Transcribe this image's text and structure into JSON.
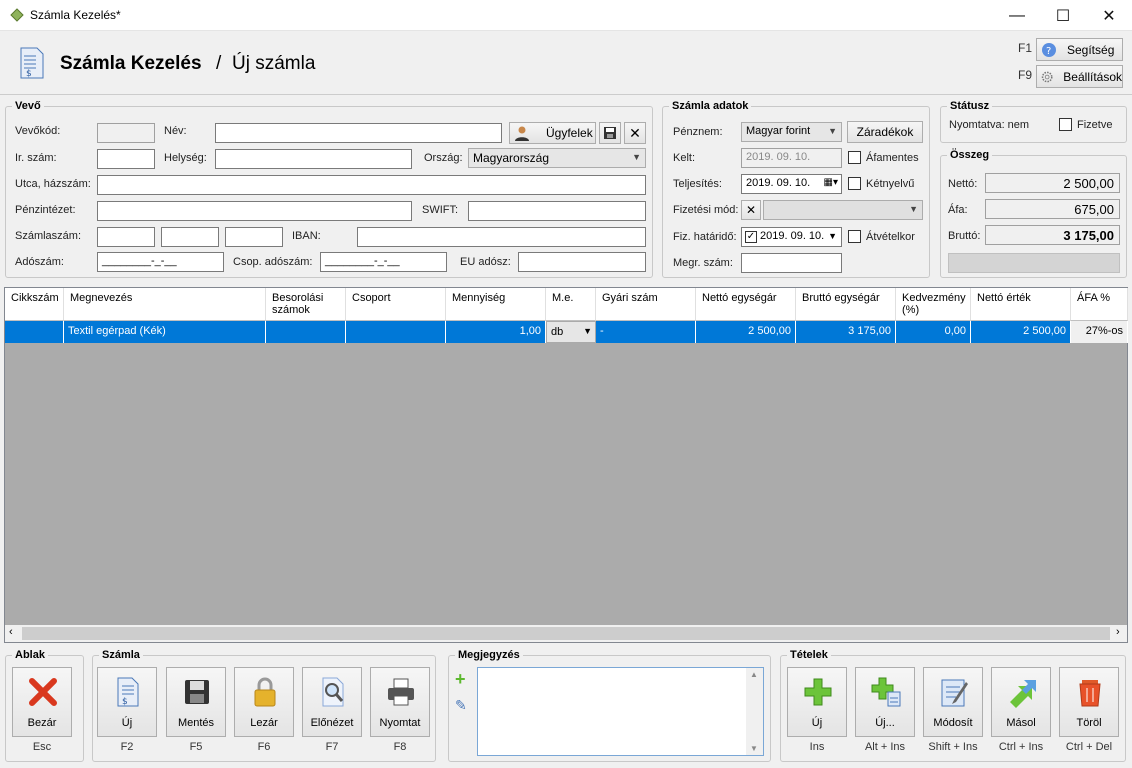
{
  "window": {
    "title": "Számla Kezelés*",
    "minimize": "—",
    "maximize": "☐",
    "close": "✕"
  },
  "header": {
    "title": "Számla Kezelés",
    "separator": "/",
    "subtitle": "Új számla",
    "help_key": "F1",
    "help_label": "Segítség",
    "settings_key": "F9",
    "settings_label": "Beállítások"
  },
  "vevo": {
    "legend": "Vevő",
    "vevokod_label": "Vevőkód:",
    "vevokod": "",
    "nev_label": "Név:",
    "nev": "",
    "ugyfelek": "Ügyfelek",
    "irszam_label": "Ir. szám:",
    "irszam": "",
    "helyseg_label": "Helység:",
    "helyseg": "",
    "orszag_label": "Ország:",
    "orszag": "Magyarország",
    "utca_label": "Utca, házszám:",
    "utca": "",
    "penzintezet_label": "Pénzintézet:",
    "penzintezet": "",
    "swift_label": "SWIFT:",
    "swift": "",
    "szamlaszam_label": "Számlaszám:",
    "iban_label": "IBAN:",
    "iban": "",
    "adoszam_label": "Adószám:",
    "adoszam_mask": "________-_-__",
    "csop_label": "Csop. adószám:",
    "csop_mask": "________-_-__",
    "eu_label": "EU adósz:",
    "eu": ""
  },
  "szamla": {
    "legend": "Számla adatok",
    "penznem_label": "Pénznem:",
    "penznem": "Magyar forint",
    "zaradekok": "Záradékok",
    "kelt_label": "Kelt:",
    "kelt": "2019. 09. 10.",
    "afamentes": "Áfamentes",
    "teljesites_label": "Teljesítés:",
    "teljesites": "2019. 09. 10.",
    "ketnyelvu": "Kétnyelvű",
    "fizmod_label": "Fizetési mód:",
    "fizmod": "",
    "hatarido_label": "Fiz. határidő:",
    "hatarido": "2019. 09. 10.",
    "atvetelkor": "Átvételkor",
    "megr_label": "Megr. szám:",
    "megr": ""
  },
  "status": {
    "legend": "Státusz",
    "nyomtatva": "Nyomtatva: nem",
    "fizetve": "Fizetve"
  },
  "osszeg": {
    "legend": "Összeg",
    "netto_label": "Nettó:",
    "netto": "2 500,00",
    "afa_label": "Áfa:",
    "afa": "675,00",
    "brutto_label": "Bruttó:",
    "brutto": "3 175,00"
  },
  "grid": {
    "headers": [
      "Cikkszám",
      "Megnevezés",
      "Besorolási számok",
      "Csoport",
      "Mennyiség",
      "M.e.",
      "Gyári szám",
      "Nettó egységár",
      "Bruttó egységár",
      "Kedvezmény (%)",
      "Nettó érték",
      "ÁFA %"
    ],
    "row": [
      "",
      "Textil egérpad (Kék)",
      "",
      "",
      "1,00",
      "db",
      "-",
      "2 500,00",
      "3 175,00",
      "0,00",
      "2 500,00",
      "27%-os"
    ]
  },
  "ablak": {
    "legend": "Ablak",
    "bezar": "Bezár",
    "bezar_key": "Esc"
  },
  "szamla_tb": {
    "legend": "Számla",
    "buttons": [
      {
        "label": "Új",
        "key": "F2"
      },
      {
        "label": "Mentés",
        "key": "F5"
      },
      {
        "label": "Lezár",
        "key": "F6"
      },
      {
        "label": "Előnézet",
        "key": "F7"
      },
      {
        "label": "Nyomtat",
        "key": "F8"
      }
    ]
  },
  "megjegyzes": {
    "legend": "Megjegyzés",
    "text": ""
  },
  "tetelek": {
    "legend": "Tételek",
    "buttons": [
      {
        "label": "Új",
        "key": "Ins"
      },
      {
        "label": "Új...",
        "key": "Alt + Ins"
      },
      {
        "label": "Módosít",
        "key": "Shift + Ins"
      },
      {
        "label": "Másol",
        "key": "Ctrl + Ins"
      },
      {
        "label": "Töröl",
        "key": "Ctrl + Del"
      }
    ]
  },
  "colors": {
    "accent": "#0078d7",
    "grid_bg": "#ababab",
    "green": "#5cb82e",
    "red": "#d9381e"
  }
}
